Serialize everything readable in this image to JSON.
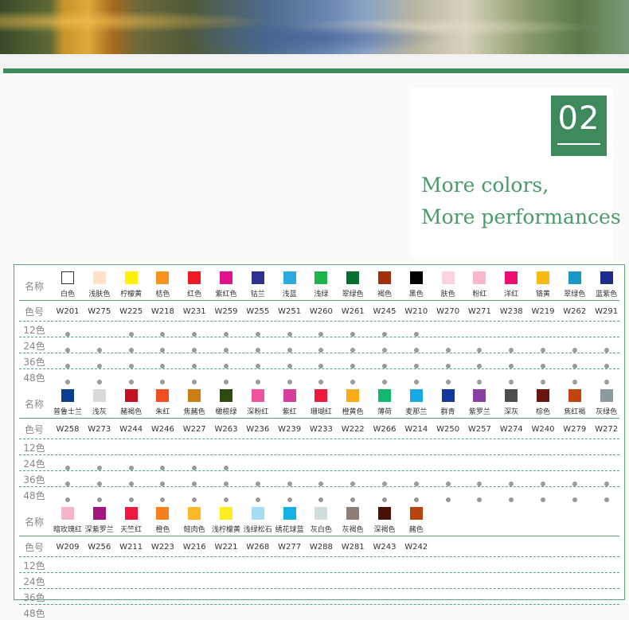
{
  "badge": {
    "number": "02"
  },
  "tagline": [
    "More colors,",
    "More performances"
  ],
  "table": {
    "name_header": "名称",
    "code_header": "色号",
    "set_labels": [
      "12色",
      "24色",
      "36色",
      "48色"
    ],
    "blocks": [
      {
        "colors": [
          {
            "name": "白色",
            "code": "W201",
            "hex": "#ffffff",
            "sets": [
              12,
              24,
              36,
              48
            ]
          },
          {
            "name": "浅肤色",
            "code": "W275",
            "hex": "#fde3c6",
            "sets": [
              24,
              36,
              48
            ]
          },
          {
            "name": "柠檬黄",
            "code": "W225",
            "hex": "#fff200",
            "sets": [
              12,
              24,
              36,
              48
            ]
          },
          {
            "name": "桔色",
            "code": "W218",
            "hex": "#f7941d",
            "sets": [
              12,
              24,
              36,
              48
            ]
          },
          {
            "name": "红色",
            "code": "W231",
            "hex": "#ed1c24",
            "sets": [
              12,
              24,
              36,
              48
            ]
          },
          {
            "name": "紫红色",
            "code": "W259",
            "hex": "#e0138c",
            "sets": [
              12,
              24,
              36,
              48
            ]
          },
          {
            "name": "钴兰",
            "code": "W255",
            "hex": "#2e3192",
            "sets": [
              12,
              24,
              36,
              48
            ]
          },
          {
            "name": "浅蓝",
            "code": "W251",
            "hex": "#29abe2",
            "sets": [
              12,
              24,
              36,
              48
            ]
          },
          {
            "name": "浅绿",
            "code": "W260",
            "hex": "#1fb24a",
            "sets": [
              12,
              24,
              36,
              48
            ]
          },
          {
            "name": "翠绿色",
            "code": "W261",
            "hex": "#067034",
            "sets": [
              12,
              24,
              36,
              48
            ]
          },
          {
            "name": "褐色",
            "code": "W245",
            "hex": "#a0300f",
            "sets": [
              12,
              24,
              36,
              48
            ]
          },
          {
            "name": "黑色",
            "code": "W210",
            "hex": "#000000",
            "sets": [
              12,
              24,
              36,
              48
            ]
          },
          {
            "name": "肤色",
            "code": "W270",
            "hex": "#fcd3e1",
            "sets": [
              24,
              36,
              48
            ]
          },
          {
            "name": "粉红",
            "code": "W271",
            "hex": "#f9b8cf",
            "sets": [
              24,
              36,
              48
            ]
          },
          {
            "name": "洋红",
            "code": "W238",
            "hex": "#ec0f6c",
            "sets": [
              24,
              36,
              48
            ]
          },
          {
            "name": "铬黄",
            "code": "W219",
            "hex": "#fdb913",
            "sets": [
              24,
              36,
              48
            ]
          },
          {
            "name": "翠绿色",
            "code": "W262",
            "hex": "#1a98c4",
            "sets": [
              24,
              36,
              48
            ]
          },
          {
            "name": "蓝紫色",
            "code": "W291",
            "hex": "#1d2c8c",
            "sets": [
              24,
              36,
              48
            ]
          }
        ]
      },
      {
        "colors": [
          {
            "name": "普鲁士兰",
            "code": "W258",
            "hex": "#0b3d91",
            "sets": [
              24,
              36,
              48
            ]
          },
          {
            "name": "浅灰",
            "code": "W273",
            "hex": "#d9d9d9",
            "sets": [
              24,
              36,
              48
            ]
          },
          {
            "name": "赭褐色",
            "code": "W244",
            "hex": "#c1121f",
            "sets": [
              24,
              36,
              48
            ]
          },
          {
            "name": "朱红",
            "code": "W246",
            "hex": "#f04e23",
            "sets": [
              24,
              36,
              48
            ]
          },
          {
            "name": "焦赭色",
            "code": "W227",
            "hex": "#c97d12",
            "sets": [
              24,
              36,
              48
            ]
          },
          {
            "name": "橄榄绿",
            "code": "W263",
            "hex": "#2d4a12",
            "sets": [
              24,
              36,
              48
            ]
          },
          {
            "name": "深粉红",
            "code": "W236",
            "hex": "#f0529c",
            "sets": [
              36,
              48
            ]
          },
          {
            "name": "紫红",
            "code": "W239",
            "hex": "#d63e9c",
            "sets": [
              36,
              48
            ]
          },
          {
            "name": "珊瑚红",
            "code": "W233",
            "hex": "#ee1c3a",
            "sets": [
              36,
              48
            ]
          },
          {
            "name": "橙黄色",
            "code": "W222",
            "hex": "#fbaa19",
            "sets": [
              36,
              48
            ]
          },
          {
            "name": "薄荷",
            "code": "W266",
            "hex": "#12b76e",
            "sets": [
              36,
              48
            ]
          },
          {
            "name": "麦那兰",
            "code": "W214",
            "hex": "#16a9e4",
            "sets": [
              36,
              48
            ]
          },
          {
            "name": "群青",
            "code": "W250",
            "hex": "#14389b",
            "sets": [
              36,
              48
            ]
          },
          {
            "name": "紫罗兰",
            "code": "W257",
            "hex": "#8a3fa6",
            "sets": [
              36,
              48
            ]
          },
          {
            "name": "深灰",
            "code": "W274",
            "hex": "#4d4d4f",
            "sets": [
              36,
              48
            ]
          },
          {
            "name": "棕色",
            "code": "W240",
            "hex": "#6b1410",
            "sets": [
              36,
              48
            ]
          },
          {
            "name": "焦红褐",
            "code": "W279",
            "hex": "#c1440e",
            "sets": [
              36,
              48
            ]
          },
          {
            "name": "灰绿色",
            "code": "W272",
            "hex": "#8a9aa0",
            "sets": [
              36,
              48
            ]
          }
        ]
      },
      {
        "colors": [
          {
            "name": "暗玫瑰红",
            "code": "W209",
            "hex": "#f8b4c8",
            "sets": []
          },
          {
            "name": "深紫罗兰",
            "code": "W256",
            "hex": "#a3167a",
            "sets": []
          },
          {
            "name": "天竺红",
            "code": "W211",
            "hex": "#f1193d",
            "sets": []
          },
          {
            "name": "橙色",
            "code": "W223",
            "hex": "#f97f1c",
            "sets": []
          },
          {
            "name": "鲑肉色",
            "code": "W216",
            "hex": "#fdb825",
            "sets": []
          },
          {
            "name": "浅柠檬黄",
            "code": "W221",
            "hex": "#fbee23",
            "sets": []
          },
          {
            "name": "浅绿松石",
            "code": "W268",
            "hex": "#a6def1",
            "sets": []
          },
          {
            "name": "绣花球蓝",
            "code": "W277",
            "hex": "#15b1e0",
            "sets": []
          },
          {
            "name": "灰白色",
            "code": "W288",
            "hex": "#d3dcdc",
            "sets": []
          },
          {
            "name": "灰褐色",
            "code": "W281",
            "hex": "#8e7e78",
            "sets": []
          },
          {
            "name": "深褐色",
            "code": "W243",
            "hex": "#4a1108",
            "sets": []
          },
          {
            "name": "赭色",
            "code": "W242",
            "hex": "#b8450d",
            "sets": []
          }
        ]
      }
    ]
  }
}
